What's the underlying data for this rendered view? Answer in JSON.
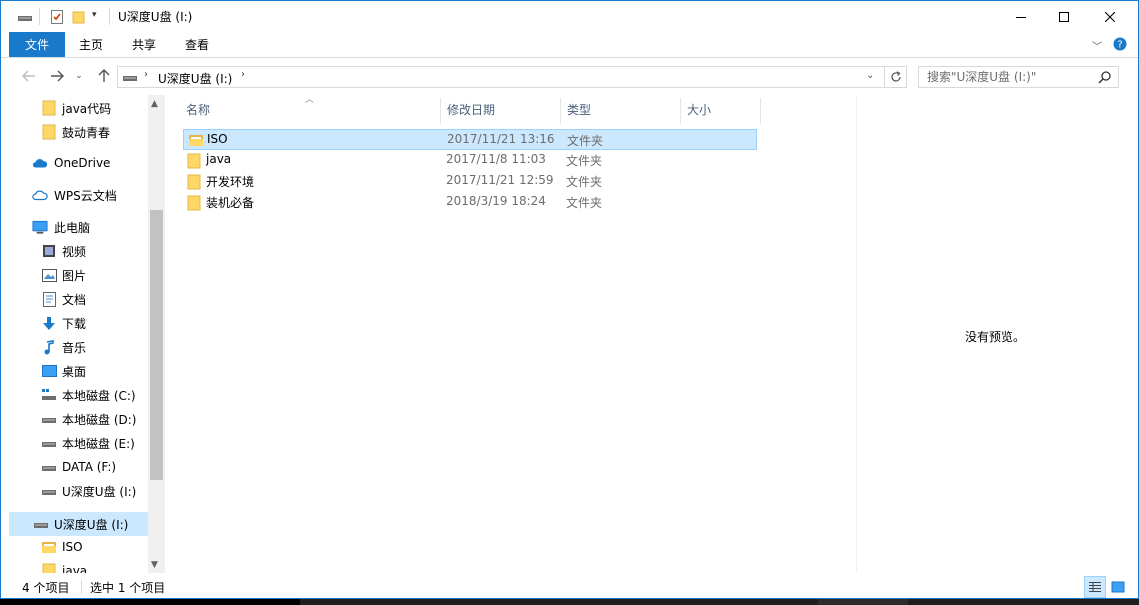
{
  "title": "U深度U盘 (I:)",
  "ribbon_tabs": [
    "文件",
    "主页",
    "共享",
    "查看"
  ],
  "address": {
    "location": "U深度U盘 (I:)"
  },
  "search": {
    "placeholder": "搜索\"U深度U盘 (I:)\""
  },
  "nav_pane": {
    "items": [
      {
        "label": "java代码",
        "icon": "folder-icon"
      },
      {
        "label": "鼓动青春",
        "icon": "folder-icon"
      },
      {
        "label": "OneDrive",
        "icon": "onedrive-cloud-icon"
      },
      {
        "label": "WPS云文档",
        "icon": "wps-cloud-icon"
      },
      {
        "label": "此电脑",
        "icon": "this-pc-icon"
      },
      {
        "label": "视频",
        "icon": "video-icon"
      },
      {
        "label": "图片",
        "icon": "pictures-icon"
      },
      {
        "label": "文档",
        "icon": "documents-icon"
      },
      {
        "label": "下载",
        "icon": "downloads-icon"
      },
      {
        "label": "音乐",
        "icon": "music-icon"
      },
      {
        "label": "桌面",
        "icon": "desktop-icon"
      },
      {
        "label": "本地磁盘 (C:)",
        "icon": "system-drive-icon"
      },
      {
        "label": "本地磁盘 (D:)",
        "icon": "drive-icon"
      },
      {
        "label": "本地磁盘 (E:)",
        "icon": "drive-icon"
      },
      {
        "label": "DATA (F:)",
        "icon": "drive-icon"
      },
      {
        "label": "U深度U盘 (I:)",
        "icon": "usb-drive-icon"
      },
      {
        "label": "U深度U盘 (I:)",
        "icon": "usb-drive-icon"
      },
      {
        "label": "ISO",
        "icon": "folder-icon"
      },
      {
        "label": "java",
        "icon": "folder-icon"
      }
    ]
  },
  "columns": [
    "名称",
    "修改日期",
    "类型",
    "大小"
  ],
  "files": [
    {
      "name": "ISO",
      "date": "2017/11/21 13:16",
      "type": "文件夹",
      "selected": true
    },
    {
      "name": "java",
      "date": "2017/11/8 11:03",
      "type": "文件夹",
      "selected": false
    },
    {
      "name": "开发环境",
      "date": "2017/11/21 12:59",
      "type": "文件夹",
      "selected": false
    },
    {
      "name": "装机必备",
      "date": "2018/3/19 18:24",
      "type": "文件夹",
      "selected": false
    }
  ],
  "preview": {
    "empty_text": "没有预览。"
  },
  "status": {
    "item_count": "4 个项目",
    "selection": "选中 1 个项目"
  },
  "colors": {
    "accent": "#1979ca",
    "selection_bg": "#cce8ff",
    "selection_border": "#99d1ff",
    "folder": "#ffd766"
  }
}
